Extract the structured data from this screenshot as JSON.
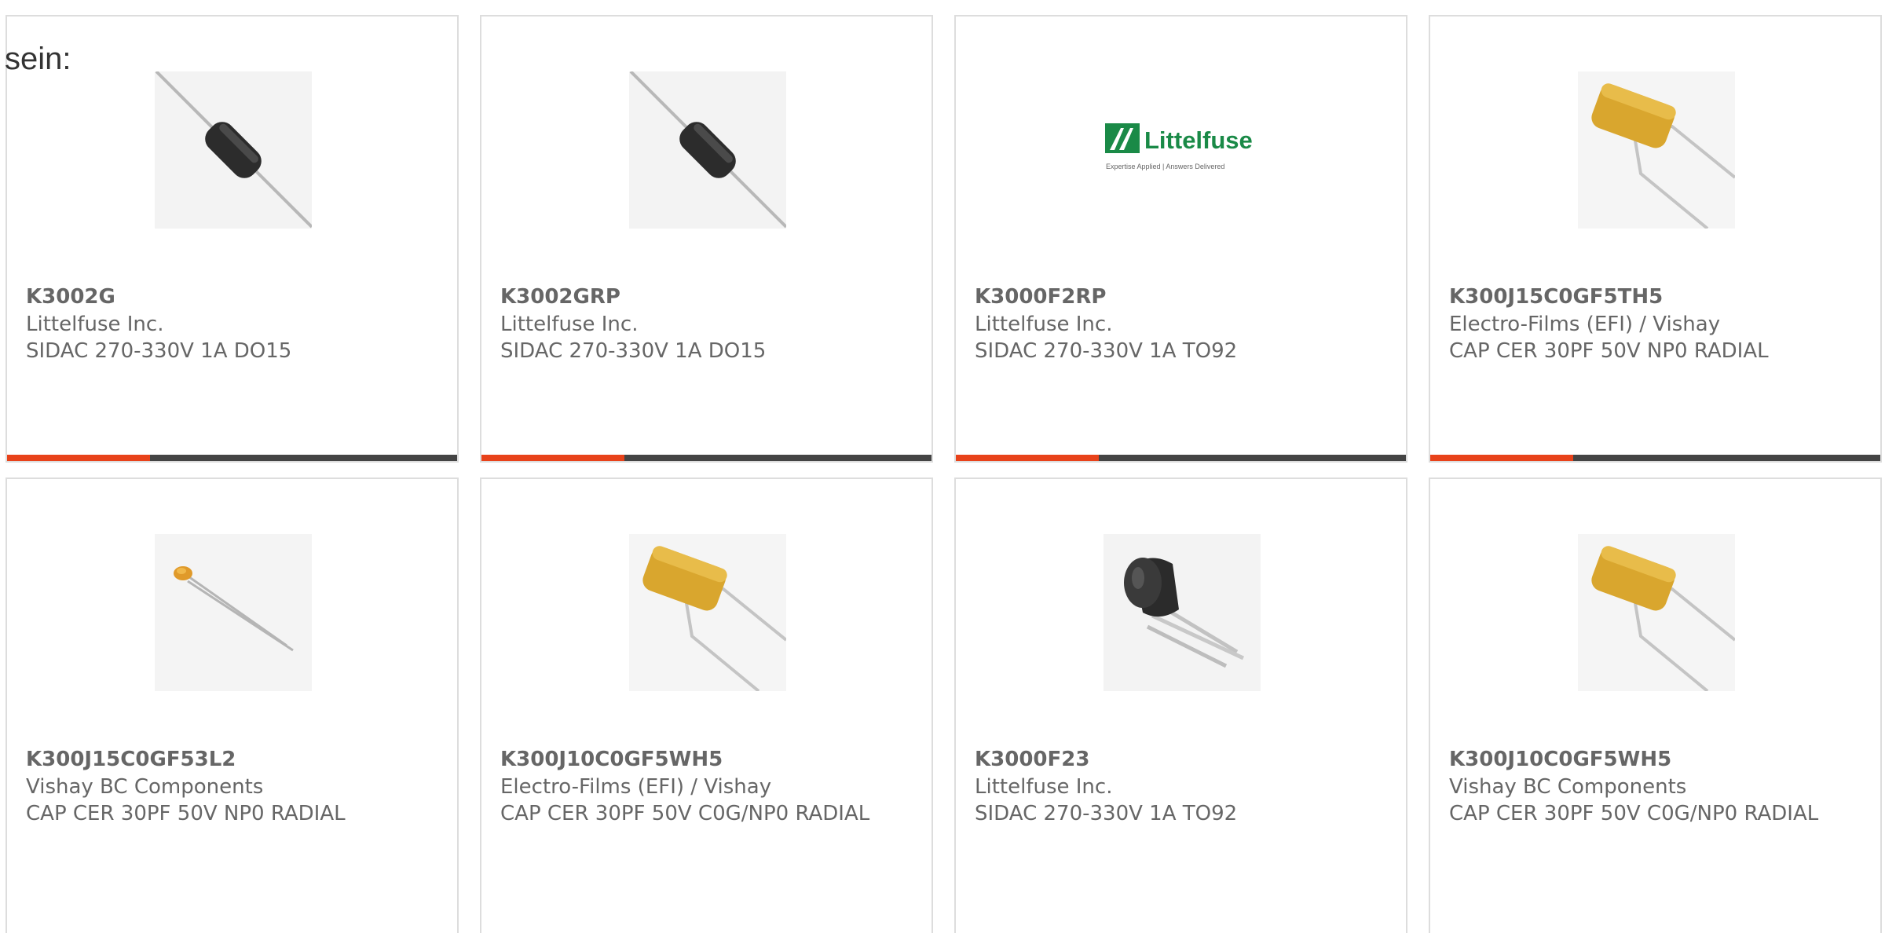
{
  "intro_text": "sein:",
  "accent_color": "#e8421a",
  "products": [
    {
      "part_number": "K3002G",
      "manufacturer": "Littelfuse Inc.",
      "description": "SIDAC 270-330V 1A DO15",
      "image": "axial-diode-icon"
    },
    {
      "part_number": "K3002GRP",
      "manufacturer": "Littelfuse Inc.",
      "description": "SIDAC 270-330V 1A DO15",
      "image": "axial-diode-icon"
    },
    {
      "part_number": "K3000F2RP",
      "manufacturer": "Littelfuse Inc.",
      "description": "SIDAC 270-330V 1A TO92",
      "image": "littelfuse-logo",
      "logo_text": "Littelfuse",
      "logo_tagline": "Expertise Applied | Answers Delivered"
    },
    {
      "part_number": "K300J15C0GF5TH5",
      "manufacturer": "Electro-Films (EFI) / Vishay",
      "description": "CAP CER 30PF 50V NP0 RADIAL",
      "image": "radial-capacitor-icon"
    },
    {
      "part_number": "K300J15C0GF53L2",
      "manufacturer": "Vishay BC Components",
      "description": "CAP CER 30PF 50V NP0 RADIAL",
      "image": "small-ceramic-capacitor-icon"
    },
    {
      "part_number": "K300J10C0GF5WH5",
      "manufacturer": "Electro-Films (EFI) / Vishay",
      "description": "CAP CER 30PF 50V C0G/NP0 RADIAL",
      "image": "radial-capacitor-icon"
    },
    {
      "part_number": "K3000F23",
      "manufacturer": "Littelfuse Inc.",
      "description": "SIDAC 270-330V 1A TO92",
      "image": "to92-package-icon"
    },
    {
      "part_number": "K300J10C0GF5WH5",
      "manufacturer": "Vishay BC Components",
      "description": "CAP CER 30PF 50V C0G/NP0 RADIAL",
      "image": "radial-capacitor-icon"
    }
  ]
}
